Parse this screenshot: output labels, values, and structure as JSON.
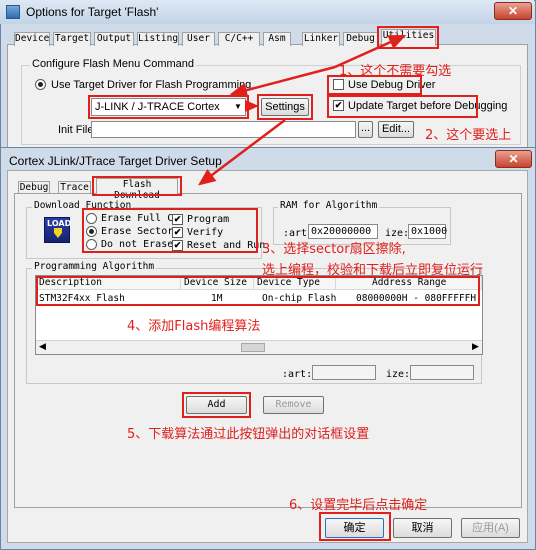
{
  "outer_window": {
    "title": "Options for Target 'Flash'",
    "close": "✕",
    "tabs": [
      "Device",
      "Target",
      "Output",
      "Listing",
      "User",
      "C/C++",
      "Asm",
      "Linker",
      "Debug",
      "Utilities"
    ],
    "active_tab": "Utilities",
    "group_label": "Configure Flash Menu Command",
    "use_target_driver": "Use Target Driver for Flash Programming",
    "use_debug_driver": "Use Debug Driver",
    "driver_select": "J-LINK / J-TRACE Cortex",
    "settings": "Settings",
    "update_target": "Update Target before Debugging",
    "init_file_label": "Init File:",
    "browse": "...",
    "edit": "Edit..."
  },
  "inner_window": {
    "title": "Cortex JLink/JTrace Target Driver Setup",
    "close": "✕",
    "tabs": [
      "Debug",
      "Trace",
      "Flash Download"
    ],
    "active_tab": "Flash Download",
    "download_function": {
      "label": "Download Function",
      "load_icon_text": "LOAD",
      "erase_full": "Erase Full C",
      "erase_sector": "Erase Sector",
      "do_not_erase": "Do not Erase",
      "program": "Program",
      "verify": "Verify",
      "reset_run": "Reset and Run"
    },
    "ram": {
      "label": "RAM for Algorithm",
      "start_label": ":art:",
      "start_value": "0x20000000",
      "size_label": "ize:",
      "size_value": "0x1000"
    },
    "programming": {
      "label": "Programming Algorithm",
      "columns": [
        "Description",
        "Device Size",
        "Device Type",
        "Address Range"
      ],
      "rows": [
        [
          "STM32F4xx Flash",
          "1M",
          "On-chip Flash",
          "08000000H - 080FFFFFH"
        ]
      ],
      "start_label": ":art:",
      "size_label": "ize:"
    },
    "add": "Add",
    "remove": "Remove",
    "ok": "确定",
    "cancel": "取消",
    "apply": "应用(A)"
  },
  "annotations": {
    "a1": "1、这个不需要勾选",
    "a2": "2、这个要选上",
    "a3_line1": "3、选择sector扇区擦除,",
    "a3_line2": "选上编程，校验和下载后立即复位运行",
    "a4": "4、添加Flash编程算法",
    "a5": "5、下载算法通过此按钮弹出的对话框设置",
    "a6": "6、设置完毕后点击确定"
  },
  "colors": {
    "annotation": "#e0201c",
    "window_frame": "#cfdbe8",
    "dialog_face": "#f0f0f0"
  }
}
